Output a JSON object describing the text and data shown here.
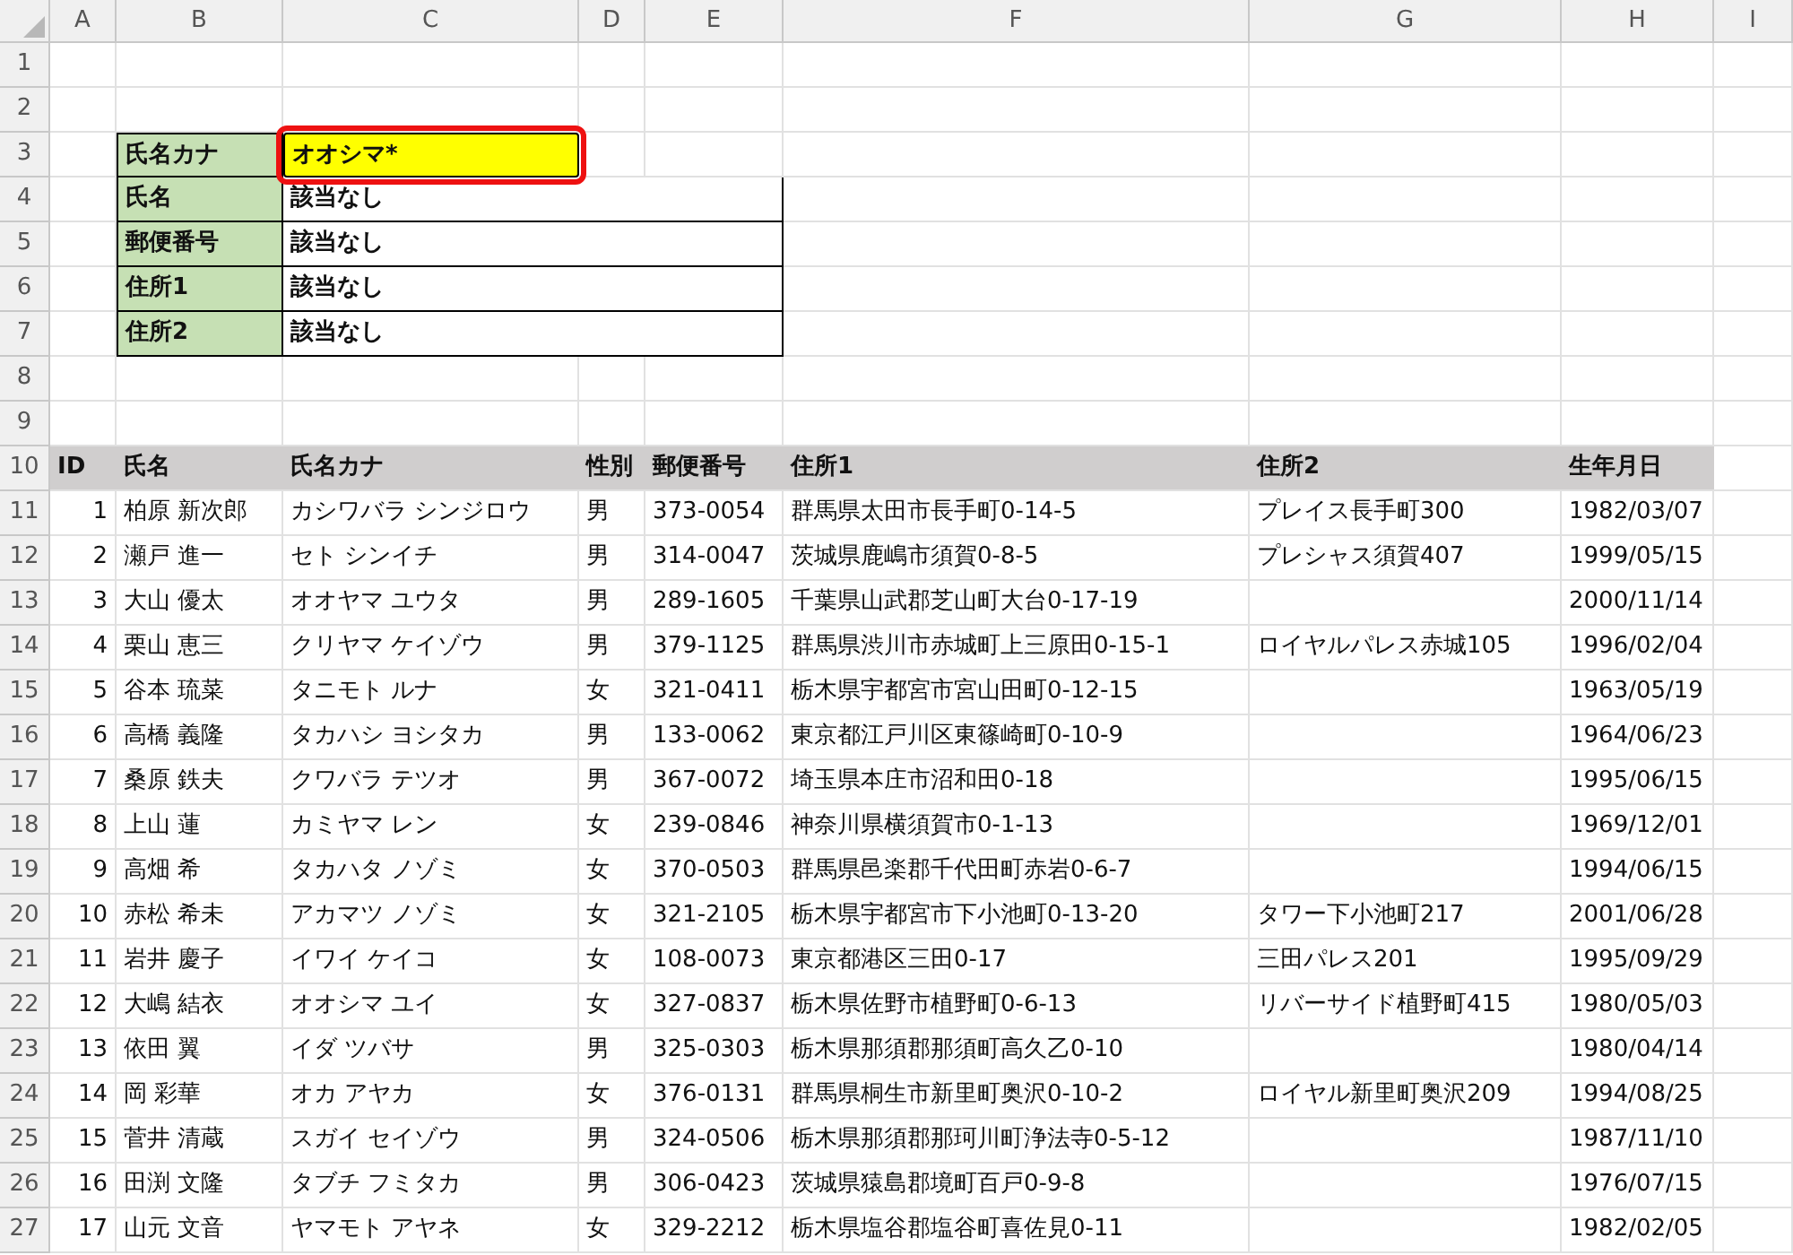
{
  "column_headers": [
    "A",
    "B",
    "C",
    "D",
    "E",
    "F",
    "G",
    "H",
    "I"
  ],
  "row_numbers": [
    "1",
    "2",
    "3",
    "4",
    "5",
    "6",
    "7",
    "8",
    "9",
    "10",
    "11",
    "12",
    "13",
    "14",
    "15",
    "16",
    "17",
    "18",
    "19",
    "20",
    "21",
    "22",
    "23",
    "24",
    "25",
    "26",
    "27"
  ],
  "lookup": {
    "key": {
      "label": "氏名カナ",
      "value": "オオシマ*",
      "highlighted": true
    },
    "results": [
      {
        "label": "氏名",
        "value": "該当なし"
      },
      {
        "label": "郵便番号",
        "value": "該当なし"
      },
      {
        "label": "住所1",
        "value": "該当なし"
      },
      {
        "label": "住所2",
        "value": "該当なし"
      }
    ]
  },
  "table": {
    "columns": [
      "ID",
      "氏名",
      "氏名カナ",
      "性別",
      "郵便番号",
      "住所1",
      "住所2",
      "生年月日"
    ],
    "rows": [
      [
        "1",
        "柏原 新次郎",
        "カシワバラ シンジロウ",
        "男",
        "373-0054",
        "群馬県太田市長手町0-14-5",
        "プレイス長手町300",
        "1982/03/07"
      ],
      [
        "2",
        "瀬戸 進一",
        "セト シンイチ",
        "男",
        "314-0047",
        "茨城県鹿嶋市須賀0-8-5",
        "プレシャス須賀407",
        "1999/05/15"
      ],
      [
        "3",
        "大山 優太",
        "オオヤマ ユウタ",
        "男",
        "289-1605",
        "千葉県山武郡芝山町大台0-17-19",
        "",
        "2000/11/14"
      ],
      [
        "4",
        "栗山 恵三",
        "クリヤマ ケイゾウ",
        "男",
        "379-1125",
        "群馬県渋川市赤城町上三原田0-15-1",
        "ロイヤルパレス赤城105",
        "1996/02/04"
      ],
      [
        "5",
        "谷本 琉菜",
        "タニモト ルナ",
        "女",
        "321-0411",
        "栃木県宇都宮市宮山田町0-12-15",
        "",
        "1963/05/19"
      ],
      [
        "6",
        "高橋 義隆",
        "タカハシ ヨシタカ",
        "男",
        "133-0062",
        "東京都江戸川区東篠崎町0-10-9",
        "",
        "1964/06/23"
      ],
      [
        "7",
        "桑原 鉄夫",
        "クワバラ テツオ",
        "男",
        "367-0072",
        "埼玉県本庄市沼和田0-18",
        "",
        "1995/06/15"
      ],
      [
        "8",
        "上山 蓮",
        "カミヤマ レン",
        "女",
        "239-0846",
        "神奈川県横須賀市0-1-13",
        "",
        "1969/12/01"
      ],
      [
        "9",
        "高畑 希",
        "タカハタ ノゾミ",
        "女",
        "370-0503",
        "群馬県邑楽郡千代田町赤岩0-6-7",
        "",
        "1994/06/15"
      ],
      [
        "10",
        "赤松 希未",
        "アカマツ ノゾミ",
        "女",
        "321-2105",
        "栃木県宇都宮市下小池町0-13-20",
        "タワー下小池町217",
        "2001/06/28"
      ],
      [
        "11",
        "岩井 慶子",
        "イワイ ケイコ",
        "女",
        "108-0073",
        "東京都港区三田0-17",
        "三田パレス201",
        "1995/09/29"
      ],
      [
        "12",
        "大嶋 結衣",
        "オオシマ ユイ",
        "女",
        "327-0837",
        "栃木県佐野市植野町0-6-13",
        "リバーサイド植野町415",
        "1980/05/03"
      ],
      [
        "13",
        "依田 翼",
        "イダ ツバサ",
        "男",
        "325-0303",
        "栃木県那須郡那須町高久乙0-10",
        "",
        "1980/04/14"
      ],
      [
        "14",
        "岡 彩華",
        "オカ アヤカ",
        "女",
        "376-0131",
        "群馬県桐生市新里町奥沢0-10-2",
        "ロイヤル新里町奥沢209",
        "1994/08/25"
      ],
      [
        "15",
        "菅井 清蔵",
        "スガイ セイゾウ",
        "男",
        "324-0506",
        "栃木県那須郡那珂川町浄法寺0-5-12",
        "",
        "1987/11/10"
      ],
      [
        "16",
        "田渕 文隆",
        "タブチ フミタカ",
        "男",
        "306-0423",
        "茨城県猿島郡境町百戸0-9-8",
        "",
        "1976/07/15"
      ],
      [
        "17",
        "山元 文音",
        "ヤマモト アヤネ",
        "女",
        "329-2212",
        "栃木県塩谷郡塩谷町喜佐見0-11",
        "",
        "1982/02/05"
      ]
    ]
  }
}
